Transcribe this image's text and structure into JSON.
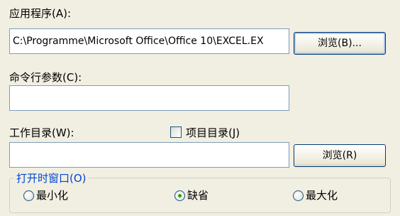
{
  "application": {
    "label": "应用程序(A):",
    "path_value": "C:\\Programme\\Microsoft Office\\Office 10\\EXCEL.EX",
    "browse_label": "浏览(B)..."
  },
  "arguments": {
    "label": "命令行参数(C):",
    "value": ""
  },
  "working_dir": {
    "label": "工作目录(W):",
    "value": "",
    "project_dir_label": "项目目录(J)",
    "project_dir_checked": false,
    "browse_label": "浏览(R)"
  },
  "open_window": {
    "legend": "打开时窗口(O)",
    "options": [
      {
        "label": "最小化",
        "selected": false
      },
      {
        "label": "缺省",
        "selected": true
      },
      {
        "label": "最大化",
        "selected": false
      }
    ]
  }
}
